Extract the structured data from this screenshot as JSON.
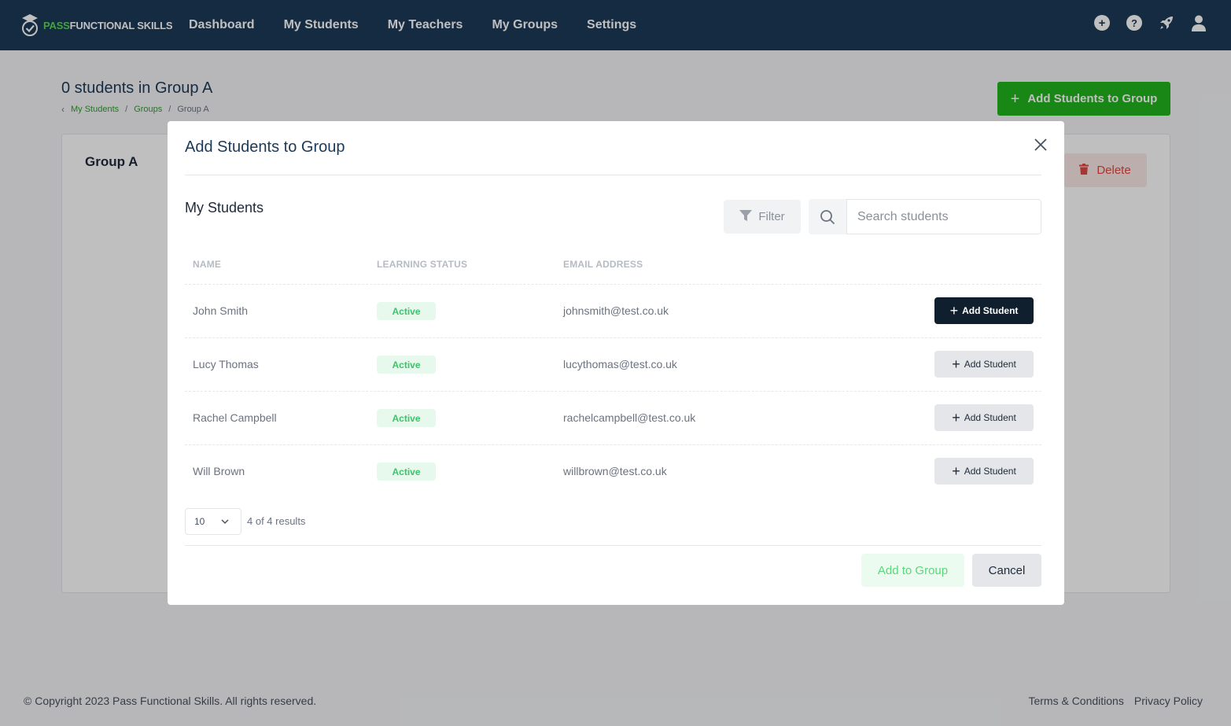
{
  "nav": {
    "logo_pass": "PASS",
    "logo_functional": "FUNCTIONAL SKILLS",
    "items": [
      {
        "label": "Dashboard"
      },
      {
        "label": "My Students"
      },
      {
        "label": "My Teachers"
      },
      {
        "label": "My Groups"
      },
      {
        "label": "Settings"
      }
    ],
    "icons": [
      "plus-circle-icon",
      "help-icon",
      "rocket-icon",
      "user-icon"
    ]
  },
  "page": {
    "title": "0 students in Group A",
    "breadcrumb": [
      "My Students",
      "Groups",
      "Group A"
    ],
    "add_button_label": "Add Students to Group",
    "group_name": "Group A",
    "delete_label": "Delete"
  },
  "modal": {
    "title": "Add Students to Group",
    "section_title": "My Students",
    "filter_label": "Filter",
    "search_placeholder": "Search students",
    "columns": [
      "NAME",
      "LEARNING STATUS",
      "EMAIL ADDRESS"
    ],
    "rows": [
      {
        "name": "John Smith",
        "status": "Active",
        "email": "johnsmith@test.co.uk",
        "action": "Add Student"
      },
      {
        "name": "Lucy Thomas",
        "status": "Active",
        "email": "lucythomas@test.co.uk",
        "action": "Add Student"
      },
      {
        "name": "Rachel Campbell",
        "status": "Active",
        "email": "rachelcampbell@test.co.uk",
        "action": "Add Student"
      },
      {
        "name": "Will Brown",
        "status": "Active",
        "email": "willbrown@test.co.uk",
        "action": "Add Student"
      }
    ],
    "page_size": "10",
    "results_text": "4 of 4 results",
    "add_to_group_label": "Add to Group",
    "cancel_label": "Cancel"
  },
  "footer": {
    "copyright": "© Copyright 2023 Pass Functional Skills. All rights reserved.",
    "links": [
      "Terms & Conditions",
      "Privacy Policy"
    ]
  },
  "colors": {
    "nav_bg": "#1c3a57",
    "primary_green": "#22b51c",
    "badge_green": "#3cc36b",
    "delete_red": "#e0473f",
    "dark_button": "#0f1f2e"
  }
}
